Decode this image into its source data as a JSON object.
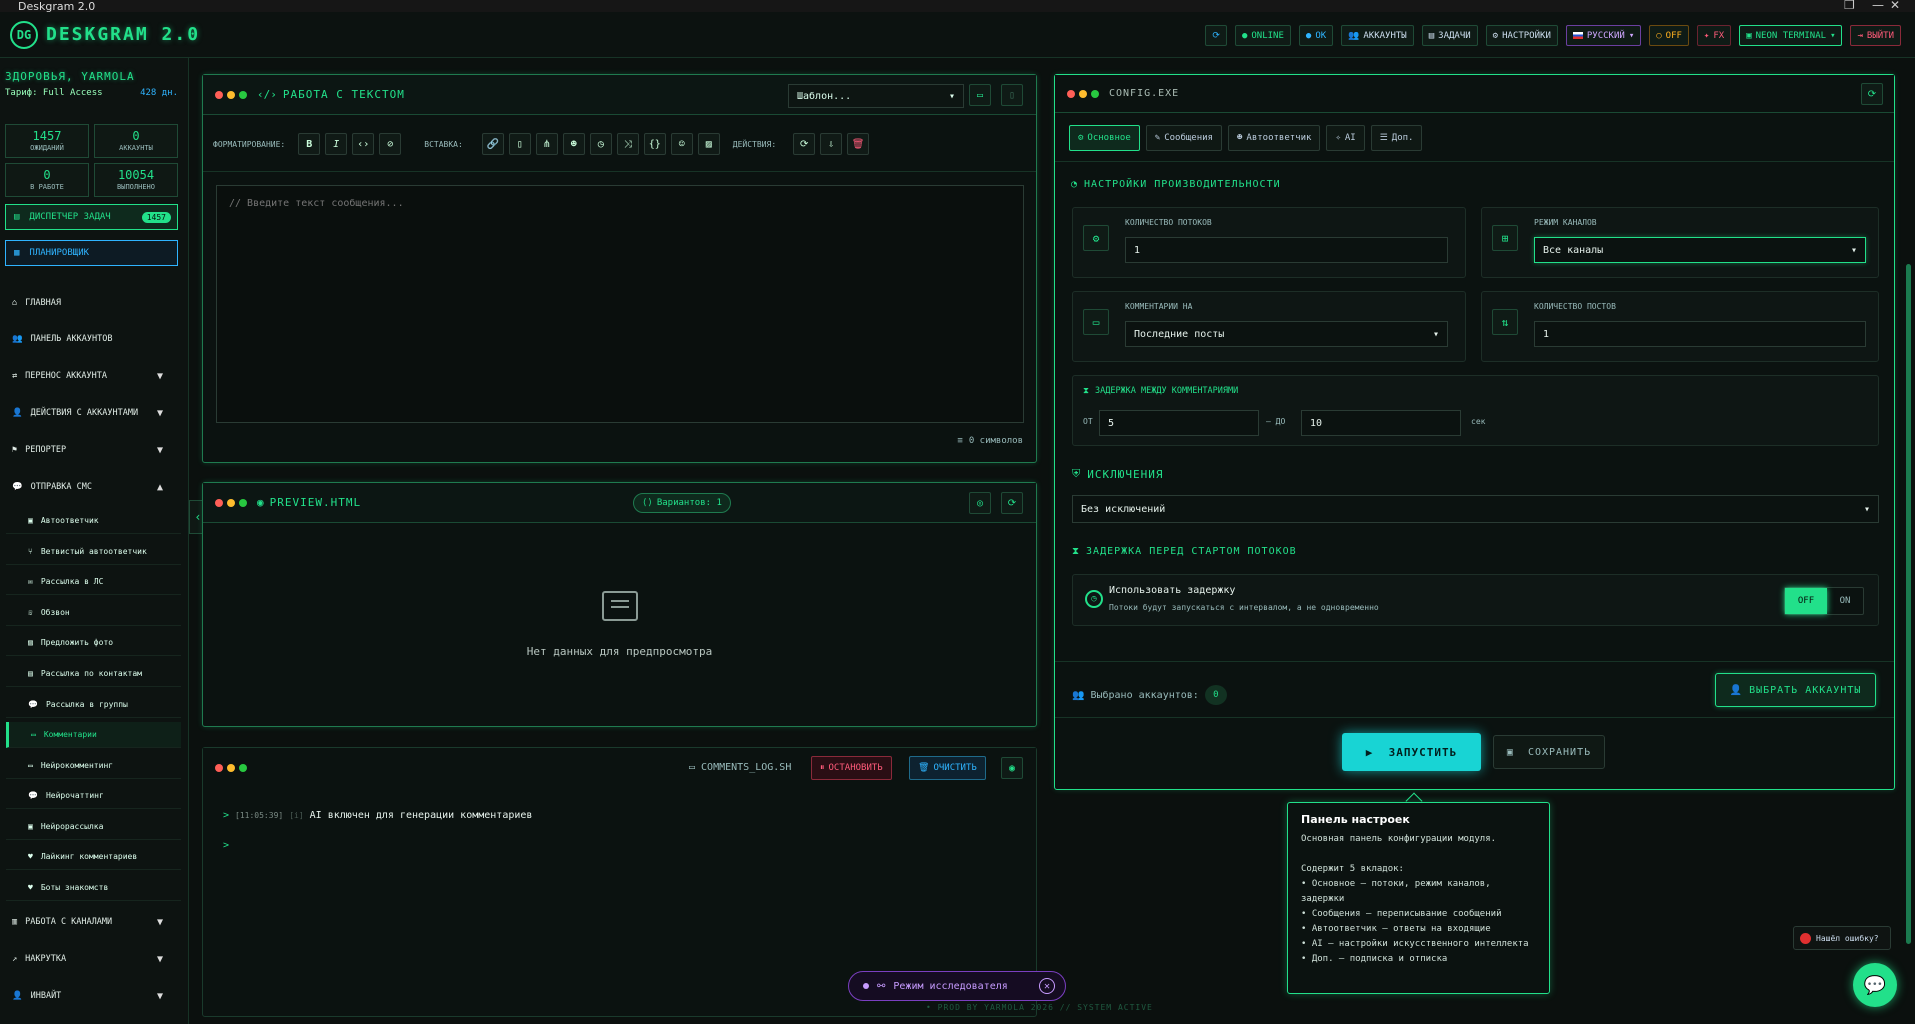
{
  "window": {
    "title": "Deskgram 2.0"
  },
  "header": {
    "logo_text": "DESKGRAM 2.0",
    "logo_mark": "DG",
    "buttons": {
      "refresh": "⟳",
      "online": "ONLINE",
      "ok": "OK",
      "accounts": "АККАУНТЫ",
      "tasks": "ЗАДАЧИ",
      "settings": "НАСТРОЙКИ",
      "lang": "РУССКИЙ",
      "off": "OFF",
      "fx": "FX",
      "theme": "NEON TERMINAL",
      "exit": "ВЫЙТИ"
    }
  },
  "sidebar": {
    "greeting": "ЗДОРОВЬЯ, YARMOLA",
    "tariff": "Тариф: Full Access",
    "days": "428 дн.",
    "stats": [
      {
        "value": "1457",
        "label": "ОЖИДАНИЙ"
      },
      {
        "value": "0",
        "label": "АККАУНТЫ"
      },
      {
        "value": "0",
        "label": "В РАБОТЕ"
      },
      {
        "value": "10054",
        "label": "ВЫПОЛНЕНО"
      }
    ],
    "dispatcher": {
      "label": "ДИСПЕТЧЕР ЗАДАЧ",
      "badge": "1457"
    },
    "planner": "ПЛАНИРОВЩИК",
    "nav": [
      "ГЛАВНАЯ",
      "ПАНЕЛЬ АККАУНТОВ",
      "ПЕРЕНОС АККАУНТА",
      "ДЕЙСТВИЯ С АККАУНТАМИ",
      "РЕПОРТЕР",
      "ОТПРАВКА СМС"
    ],
    "sub": [
      "Автоответчик",
      "Ветвистый автоответчик",
      "Рассылка в ЛС",
      "Обзвон",
      "Предложить фото",
      "Рассылка по контактам",
      "Рассылка в группы",
      "Комментарии",
      "Нейрокомментинг",
      "Нейрочаттинг",
      "Нейрорассылка",
      "Лайкинг комментариев",
      "Боты знакомств"
    ],
    "nav_bottom": [
      "РАБОТА С КАНАЛАМИ",
      "НАКРУТКА",
      "ИНВАЙТ"
    ]
  },
  "text_panel": {
    "title": "РАБОТА С ТЕКСТОМ",
    "template_select": "Шаблон...",
    "format_label": "ФОРМАТИРОВАНИЕ:",
    "insert_label": "ВСТАВКА:",
    "actions_label": "ДЕЙСТВИЯ:",
    "format_btns": [
      "B",
      "I",
      "‹›",
      "⊘"
    ],
    "placeholder": "// Введите текст сообщения...",
    "char_count": "0 символов"
  },
  "preview_panel": {
    "title": "PREVIEW.HTML",
    "variants": "Вариантов: 1",
    "empty": "Нет данных для предпросмотра"
  },
  "log_panel": {
    "file": "COMMENTS_LOG.SH",
    "stop": "ОСТАНОВИТЬ",
    "clear": "ОЧИСТИТЬ",
    "line_time": "[11:05:39]",
    "line_tag": "[i]",
    "line_text": "AI включен для генерации комментариев",
    "prompt": ">"
  },
  "config": {
    "title": "CONFIG.EXE",
    "tabs": [
      "Основное",
      "Сообщения",
      "Автоответчик",
      "AI",
      "Доп."
    ],
    "perf_title": "НАСТРОЙКИ ПРОИЗВОДИТЕЛЬНОСТИ",
    "threads_label": "КОЛИЧЕСТВО ПОТОКОВ",
    "threads_value": "1",
    "channel_mode_label": "РЕЖИМ КАНАЛОВ",
    "channel_mode_value": "Все каналы",
    "comments_on_label": "КОММЕНТАРИИ НА",
    "comments_on_value": "Последние посты",
    "posts_count_label": "КОЛИЧЕСТВО ПОСТОВ",
    "posts_count_value": "1",
    "delay_title": "ЗАДЕРЖКА МЕЖДУ КОММЕНТАРИЯМИ",
    "from_label": "ОТ",
    "from_value": "5",
    "to_label": "— ДО",
    "to_value": "10",
    "sec_label": "сек",
    "excl_title": "ИСКЛЮЧЕНИЯ",
    "excl_value": "Без исключений",
    "start_delay_title": "ЗАДЕРЖКА ПЕРЕД СТАРТОМ ПОТОКОВ",
    "use_delay": "Использовать задержку",
    "use_delay_desc": "Потоки будут запускаться с интервалом, а не одновременно",
    "toggle_off": "OFF",
    "toggle_on": "ON",
    "selected_accounts": "Выбрано аккаунтов:",
    "selected_count": "0",
    "choose_accounts": "ВЫБРАТЬ АККАУНТЫ",
    "launch": "ЗАПУСТИТЬ",
    "save": "СОХРАНИТЬ"
  },
  "tooltip": {
    "title": "Панель настроек",
    "body": "Основная панель конфигурации модуля.\n\nСодержит 5 вкладок:\n• Основное — потоки, режим каналов, задержки\n• Сообщения — переписывание сообщений\n• Автоответчик — ответы на входящие\n• AI — настройки искусственного интеллекта\n• Доп. — подписка и отписка"
  },
  "research_mode": "Режим исследователя",
  "footer": "• PROD BY YARMOLA 2026 // SYSTEM ACTIVE",
  "bug_report": "Нашёл ошибку?"
}
